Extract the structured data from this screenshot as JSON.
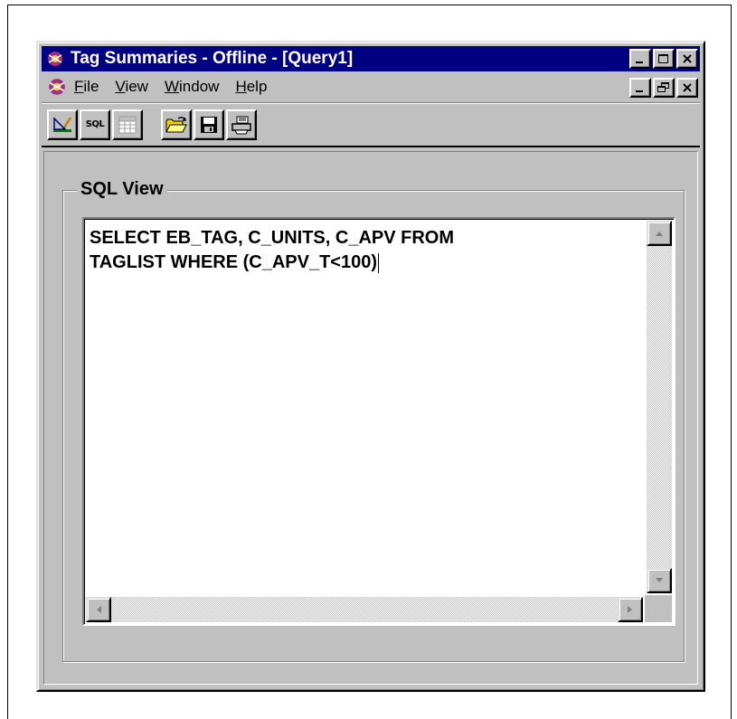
{
  "window": {
    "title": "Tag Summaries - Offline - [Query1]"
  },
  "menu": {
    "items": [
      {
        "key": "F",
        "rest": "ile"
      },
      {
        "key": "V",
        "rest": "iew"
      },
      {
        "key": "W",
        "rest": "indow"
      },
      {
        "key": "H",
        "rest": "elp"
      }
    ]
  },
  "toolbar": {
    "sql_label": "SQL",
    "buttons": [
      "design-view-icon",
      "sql-view-icon",
      "datasheet-view-icon",
      "open-folder-icon",
      "save-disk-icon",
      "print-icon"
    ]
  },
  "sql_view": {
    "group_label": "SQL View",
    "query_line1": "SELECT EB_TAG, C_UNITS, C_APV FROM",
    "query_line2": "TAGLIST WHERE (C_APV_T<100)"
  },
  "colors": {
    "titlebar": "#000080",
    "face": "#c0c0c0"
  }
}
